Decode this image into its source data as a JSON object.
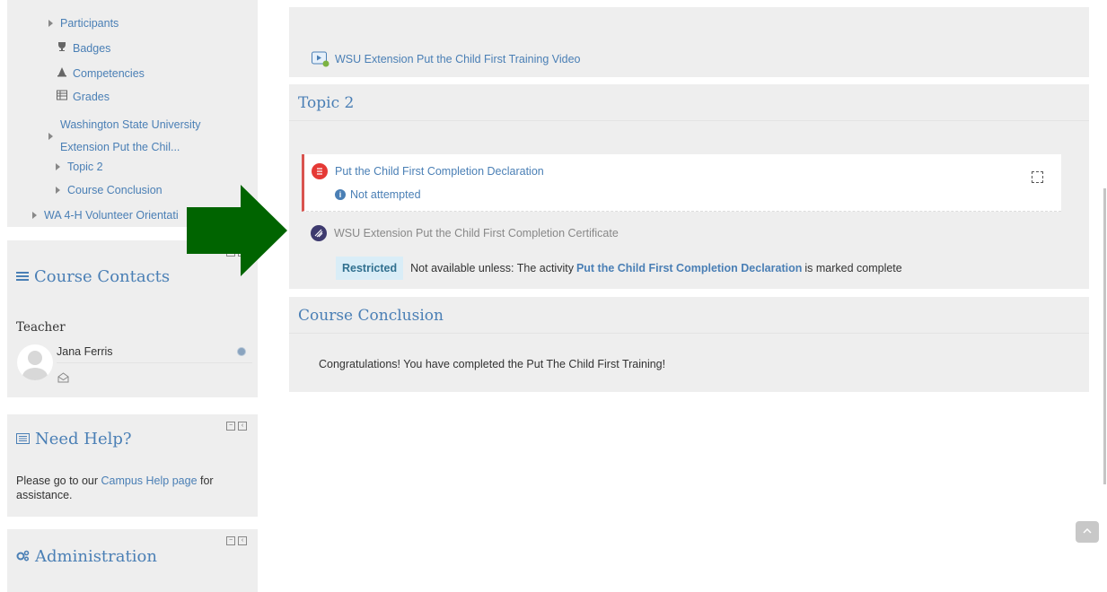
{
  "nav": {
    "items": [
      {
        "label": "Participants"
      },
      {
        "label": "Badges"
      },
      {
        "label": "Competencies"
      },
      {
        "label": "Grades"
      },
      {
        "label_line1": "Washington State University",
        "label_line2": "Extension Put the Chil..."
      },
      {
        "label": "Topic 2"
      },
      {
        "label": "Course Conclusion"
      },
      {
        "label": "WA 4-H Volunteer Orientati"
      }
    ]
  },
  "contacts": {
    "title": "Course Contacts",
    "role": "Teacher",
    "teacher_name": "Jana Ferris"
  },
  "help": {
    "title": "Need Help?",
    "text_before": "Please go to our ",
    "link": "Campus Help page",
    "text_after": " for assistance."
  },
  "admin": {
    "title": "Administration"
  },
  "video_section": {
    "activity": "WSU Extension Put the Child First Training Video"
  },
  "topic2": {
    "title": "Topic 2",
    "declaration": {
      "name": "Put the Child First Completion Declaration",
      "status": "Not attempted"
    },
    "certificate": {
      "name": "WSU Extension Put the Child First Completion Certificate",
      "badge": "Restricted",
      "text_before": "Not available unless: The activity ",
      "activity_link": "Put the Child First Completion Declaration",
      "text_after": " is marked complete"
    }
  },
  "conclusion": {
    "title": "Course Conclusion",
    "text": "Congratulations! You have completed the Put The Child First Training!"
  },
  "colors": {
    "link": "#4a7fb5",
    "arrow": "#006400",
    "restricted_bg": "#d9edf7",
    "declaration_border": "#d9534f"
  },
  "icons": {
    "scroll_top": "chevron-up-icon"
  }
}
